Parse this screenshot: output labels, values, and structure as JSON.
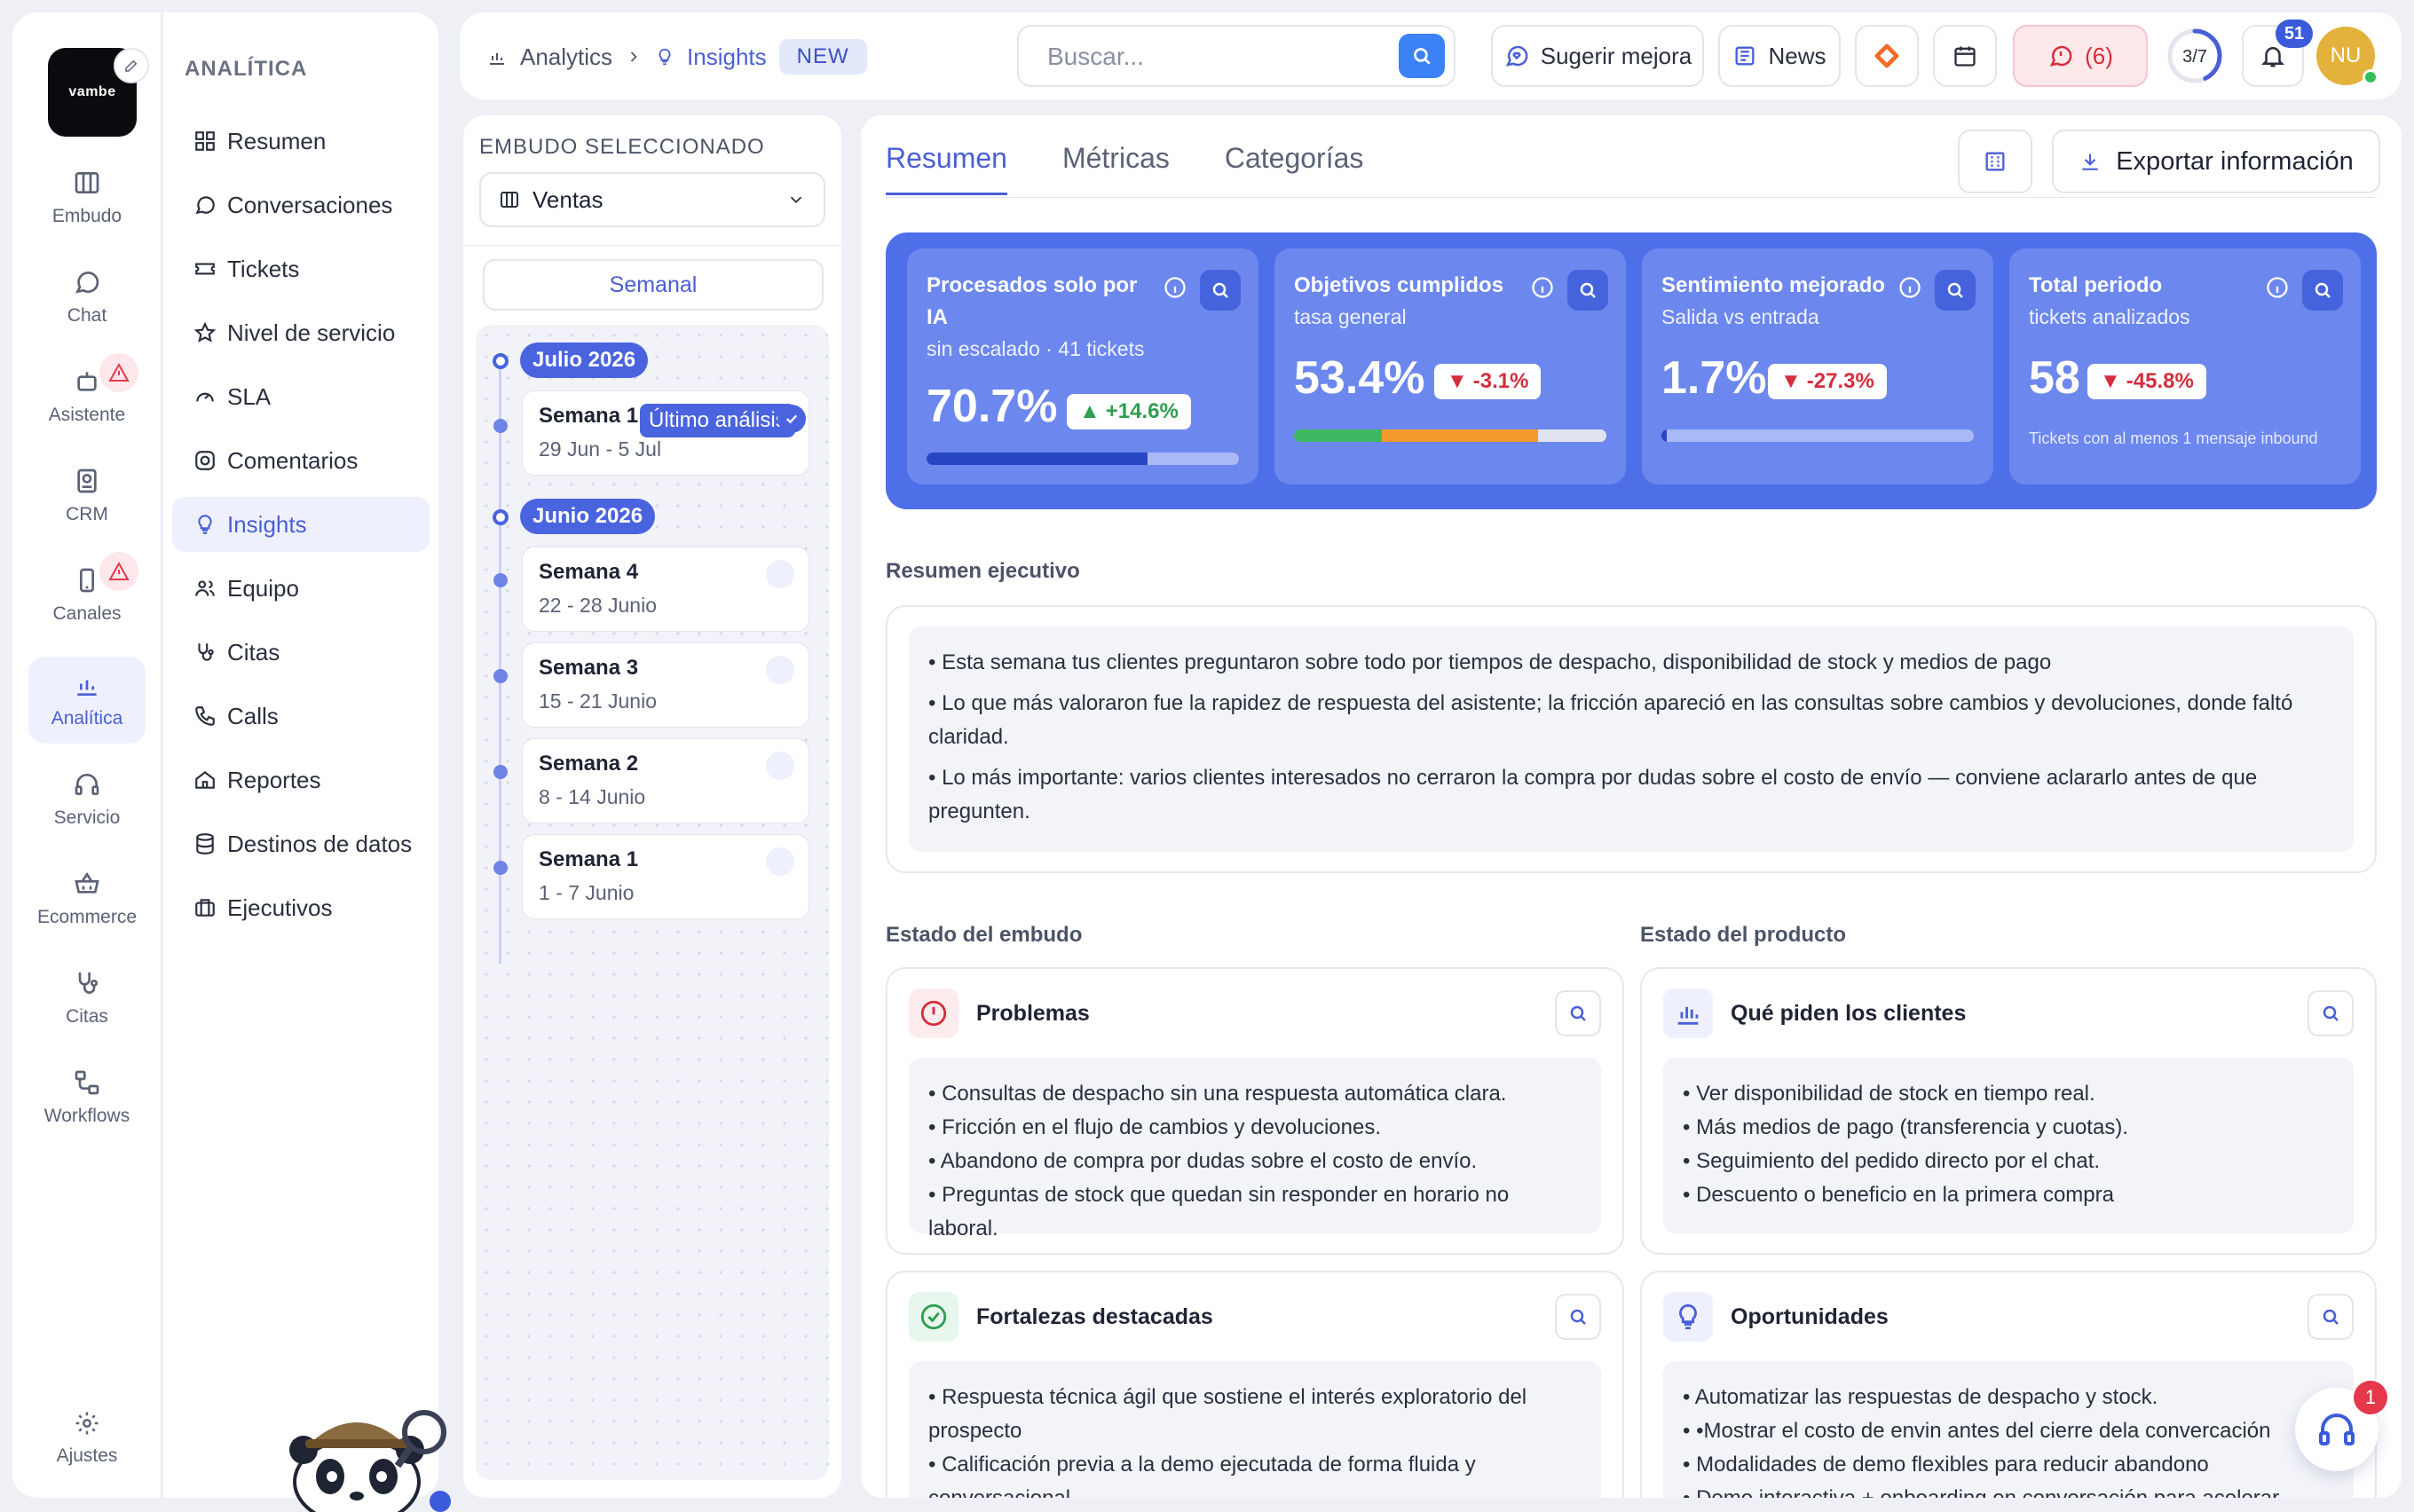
{
  "rail": {
    "logo_text": "vambe",
    "items": [
      {
        "label": "Embudo",
        "icon": "columns-icon"
      },
      {
        "label": "Chat",
        "icon": "chat-icon"
      },
      {
        "label": "Asistente",
        "icon": "bot-icon"
      },
      {
        "label": "CRM",
        "icon": "contact-icon"
      },
      {
        "label": "Canales",
        "icon": "phone-icon"
      },
      {
        "label": "Analítica",
        "icon": "bar-chart-icon"
      },
      {
        "label": "Servicio",
        "icon": "headset-icon"
      },
      {
        "label": "Ecommerce",
        "icon": "basket-icon"
      },
      {
        "label": "Citas",
        "icon": "stethoscope-icon"
      },
      {
        "label": "Workflows",
        "icon": "workflow-icon"
      }
    ],
    "settings_label": "Ajustes"
  },
  "menu": {
    "title": "ANALÍTICA",
    "items": [
      {
        "label": "Resumen"
      },
      {
        "label": "Conversaciones"
      },
      {
        "label": "Tickets"
      },
      {
        "label": "Nivel de servicio"
      },
      {
        "label": "SLA"
      },
      {
        "label": "Comentarios"
      },
      {
        "label": "Insights"
      },
      {
        "label": "Equipo"
      },
      {
        "label": "Citas"
      },
      {
        "label": "Calls"
      },
      {
        "label": "Reportes"
      },
      {
        "label": "Destinos de datos"
      },
      {
        "label": "Ejecutivos"
      }
    ]
  },
  "topbar": {
    "crumb1": "Analytics",
    "crumb2": "Insights",
    "new_badge": "NEW",
    "search_placeholder": "Buscar...",
    "suggest_label": "Sugerir mejora",
    "news_label": "News",
    "alerts_label": "(6)",
    "progress_text": "3/7",
    "progress_fraction": 0.43,
    "notifications_count": "51",
    "avatar_initials": "NU"
  },
  "funnel": {
    "label": "EMBUDO SELECCIONADO",
    "selected": "Ventas",
    "period": "Semanal",
    "months": [
      {
        "label": "Julio 2026"
      },
      {
        "label": "Junio 2026"
      }
    ],
    "weeks": [
      {
        "name": "Semana 1",
        "range": "29 Jun - 5 Jul",
        "badge": "Último análisis"
      },
      {
        "name": "Semana 4",
        "range": "22 - 28 Junio"
      },
      {
        "name": "Semana 3",
        "range": "15 - 21 Junio"
      },
      {
        "name": "Semana 2",
        "range": "8 - 14 Junio"
      },
      {
        "name": "Semana 1",
        "range": "1 - 7 Junio"
      }
    ]
  },
  "main": {
    "tabs": [
      "Resumen",
      "Métricas",
      "Categorías"
    ],
    "export_label": "Exportar información",
    "kpis": [
      {
        "title": "Procesados solo por IA",
        "subtitle": "sin escalado · 41 tickets",
        "value": "70.7%",
        "delta": "+14.6%",
        "progress": 0.707
      },
      {
        "title": "Objetivos cumplidos",
        "subtitle": "tasa general",
        "value": "53.4%",
        "delta": "-3.1%"
      },
      {
        "title": "Sentimiento mejorado",
        "subtitle": "Salida vs entrada",
        "value": "1.7%",
        "delta": "-27.3%",
        "progress": 0.017
      },
      {
        "title": "Total periodo",
        "subtitle": "tickets analizados",
        "value": "58",
        "delta": "-45.8%",
        "note": "Tickets con al menos 1 mensaje inbound"
      }
    ],
    "exec_title": "Resumen ejecutivo",
    "exec_bullets": [
      "• Esta semana tus clientes preguntaron sobre todo por tiempos de despacho, disponibilidad de stock y medios de pago",
      "• Lo que más valoraron fue la rapidez de respuesta del asistente; la fricción apareció en las consultas sobre cambios y devoluciones, donde faltó claridad.",
      "• Lo más importante: varios clientes interesados no cerraron la compra por dudas sobre el costo de envío — conviene aclararlo antes de que pregunten."
    ],
    "funnel_state_title": "Estado del embudo",
    "product_state_title": "Estado del producto",
    "problems": {
      "title": "Problemas",
      "items": [
        "• Consultas de despacho sin una respuesta automática clara.",
        "• Fricción en el flujo de cambios y devoluciones.",
        "• Abandono de compra por dudas sobre el costo de envío.",
        "• Preguntas de stock que quedan sin responder en horario no laboral."
      ]
    },
    "requests": {
      "title": "Qué piden los clientes",
      "items": [
        "• Ver disponibilidad de stock en tiempo real.",
        "• Más medios de pago (transferencia y cuotas).",
        "• Seguimiento del pedido directo por el chat.",
        "• Descuento o beneficio en la primera compra"
      ]
    },
    "strengths": {
      "title": "Fortalezas destacadas",
      "items": [
        "• Respuesta técnica ágil que sostiene el interés exploratorio del prospecto",
        "• Calificación previa a la demo ejecutada de forma fluida y conversacional"
      ]
    },
    "opportunities": {
      "title": "Oportunidades",
      "items": [
        "• Automatizar las respuestas de despacho y stock.",
        "• •Mostrar el costo de envin antes del cierre dela convercación",
        "• Modalidades de demo flexibles para reducir abandono",
        "• Demo interactiva + onboarding en conversación para acelerar"
      ]
    }
  },
  "help_badge": "1",
  "colors": {
    "accent": "#4a5fd6",
    "kpi_panel": "#4f6fe8",
    "danger": "#d52d3c",
    "success": "#2e9e4f"
  }
}
